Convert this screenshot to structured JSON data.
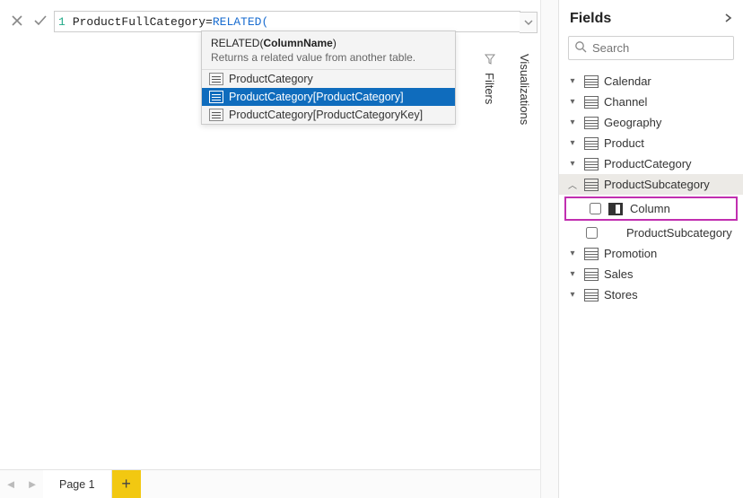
{
  "formula": {
    "line": "1",
    "varPart": "ProductFullCategory=",
    "fnPart": "RELATED(",
    "tooltip": {
      "fn": "RELATED",
      "arg": "ColumnName",
      "desc": "Returns a related value from another table."
    },
    "suggestions": [
      {
        "label": "ProductCategory",
        "selected": false
      },
      {
        "label": "ProductCategory[ProductCategory]",
        "selected": true
      },
      {
        "label": "ProductCategory[ProductCategoryKey]",
        "selected": false
      }
    ]
  },
  "sidePanels": {
    "filters": "Filters",
    "visualizations": "Visualizations"
  },
  "pages": {
    "page1": "Page 1"
  },
  "fieldsPanel": {
    "title": "Fields",
    "searchPlaceholder": "Search",
    "tables": [
      {
        "name": "Calendar",
        "expanded": false
      },
      {
        "name": "Channel",
        "expanded": false
      },
      {
        "name": "Geography",
        "expanded": false
      },
      {
        "name": "Product",
        "expanded": false
      },
      {
        "name": "ProductCategory",
        "expanded": false
      },
      {
        "name": "ProductSubcategory",
        "expanded": true,
        "active": true,
        "children": [
          {
            "label": "Column",
            "highlighted": true,
            "hasColIcon": true
          },
          {
            "label": "ProductSubcategory",
            "highlighted": false,
            "hasColIcon": false
          }
        ]
      },
      {
        "name": "Promotion",
        "expanded": false
      },
      {
        "name": "Sales",
        "expanded": false
      },
      {
        "name": "Stores",
        "expanded": false
      }
    ]
  }
}
